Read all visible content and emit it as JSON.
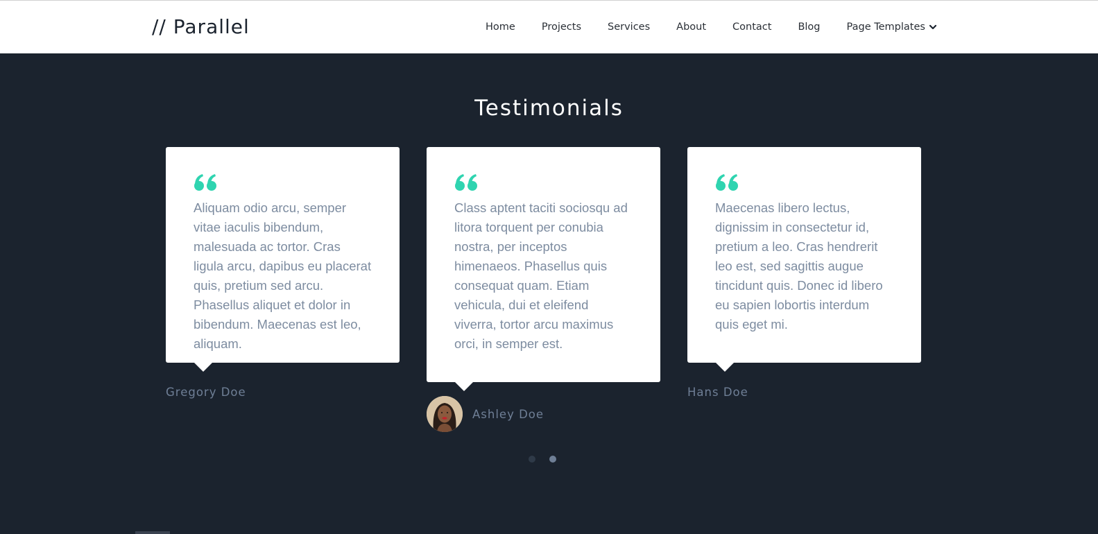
{
  "header": {
    "brand": "// Parallel",
    "nav": [
      {
        "label": "Home"
      },
      {
        "label": "Projects"
      },
      {
        "label": "Services"
      },
      {
        "label": "About"
      },
      {
        "label": "Contact"
      },
      {
        "label": "Blog"
      },
      {
        "label": "Page Templates",
        "icon": "chevron-down-icon"
      }
    ]
  },
  "testimonials": {
    "title": "Testimonials",
    "items": [
      {
        "quote": "Aliquam odio arcu, semper vitae iaculis bibendum, malesuada ac tortor. Cras ligula arcu, dapibus eu placerat quis, pretium sed arcu. Phasellus aliquet et dolor in bibendum. Maecenas est leo, aliquam.",
        "author": "Gregory Doe",
        "has_avatar": false
      },
      {
        "quote": "Class aptent taciti sociosqu ad litora torquent per conubia nostra, per inceptos himenaeos. Phasellus quis consequat quam. Etiam vehicula, dui et eleifend viverra, tortor arcu maximus orci, in semper est.",
        "author": "Ashley Doe",
        "has_avatar": true
      },
      {
        "quote": "Maecenas libero lectus, dignissim in consectetur id, pretium a leo. Cras hendrerit leo est, sed sagittis augue tincidunt quis. Donec id libero eu sapien lobortis interdum quis eget mi.",
        "author": "Hans Doe",
        "has_avatar": false
      }
    ],
    "pager": {
      "pages": 2,
      "active_index": 1
    }
  },
  "colors": {
    "page_background": "#1b232e",
    "header_background": "#ffffff",
    "card_background": "#ffffff",
    "accent": "#2fd4b0",
    "quote_text": "#7d8ca0",
    "author_text": "#6f7f96",
    "dot_inactive": "#2f3a48",
    "dot_active": "#6f7f96"
  }
}
